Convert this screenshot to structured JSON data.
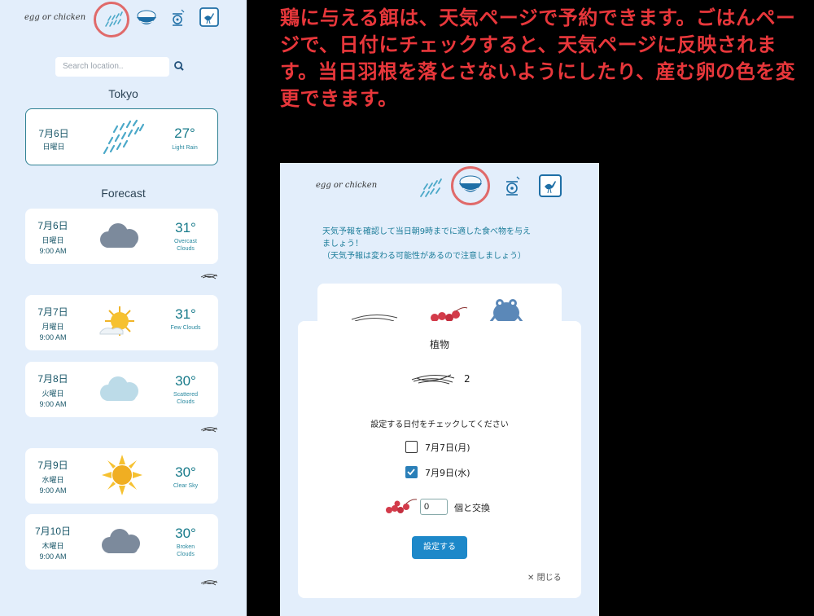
{
  "colors": {
    "page_bg": "#e3eefb",
    "accent": "#1d88c9",
    "highlight_ring": "#e06a6a",
    "headline": "#e8373b",
    "text_teal": "#177a8a"
  },
  "left_app": {
    "logo": "egg or chicken",
    "nav_icons": [
      "rain-icon",
      "rice-bowl-icon",
      "spinner-icon",
      "ostrich-icon"
    ],
    "search": {
      "placeholder": "Search location.."
    },
    "city": "Tokyo",
    "current": {
      "date": "7月6日",
      "weekday": "日曜日",
      "temp": "27°",
      "desc": "Light Rain",
      "icon": "rain-icon"
    },
    "forecast_title": "Forecast",
    "forecast": [
      {
        "date": "7月6日",
        "weekday": "日曜日",
        "time": "9:00 AM",
        "temp": "31°",
        "desc_l1": "Overcast",
        "desc_l2": "Clouds",
        "icon": "dark-cloud-icon"
      },
      {
        "date": "7月7日",
        "weekday": "月曜日",
        "time": "9:00 AM",
        "temp": "31°",
        "desc_l1": "Few Clouds",
        "desc_l2": "",
        "icon": "sun-cloud-icon"
      },
      {
        "date": "7月8日",
        "weekday": "火曜日",
        "time": "9:00 AM",
        "temp": "30°",
        "desc_l1": "Scattered",
        "desc_l2": "Clouds",
        "icon": "light-cloud-icon"
      },
      {
        "date": "7月9日",
        "weekday": "水曜日",
        "time": "9:00 AM",
        "temp": "30°",
        "desc_l1": "Clear Sky",
        "desc_l2": "",
        "icon": "sun-icon"
      },
      {
        "date": "7月10日",
        "weekday": "木曜日",
        "time": "9:00 AM",
        "temp": "30°",
        "desc_l1": "Broken",
        "desc_l2": "Clouds",
        "icon": "dark-cloud-icon"
      }
    ]
  },
  "headline": "鶏に与える餌は、天気ページで予約できます。ごはんページで、日付にチェックすると、天気ページに反映されます。当日羽根を落とさないようにしたり、産む卵の色を変更できます。",
  "right_app": {
    "logo": "egg or chicken",
    "info_l1": "天気予報を確認して当日朝9時までに適した食べ物を与え",
    "info_l2": "ましょう！",
    "info_l3": "（天気予報は変わる可能性があるので注意しましょう）",
    "modal": {
      "title": "植物",
      "count": "2",
      "prompt": "設定する日付をチェックしてください",
      "options": [
        {
          "label": "7月7日(月)",
          "checked": false
        },
        {
          "label": "7月9日(水)",
          "checked": true
        }
      ],
      "qty_value": "0",
      "qty_label": "個と交換",
      "submit": "設定する",
      "close": "閉じる"
    }
  }
}
